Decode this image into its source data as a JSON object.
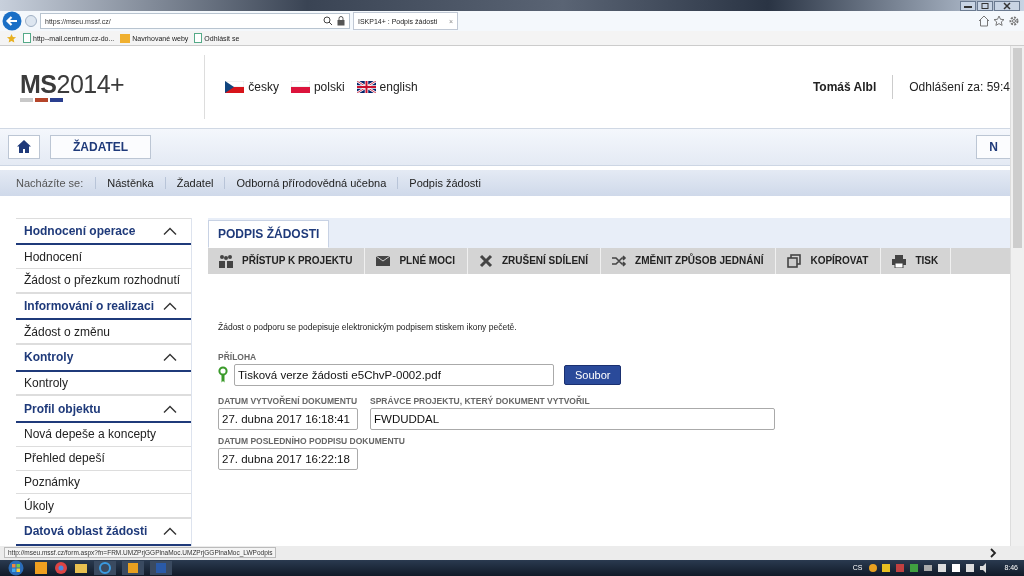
{
  "browser": {
    "address": "https://mseu.mssf.cz/",
    "tab": {
      "title": "ISKP14+ : Podpis žádosti",
      "close": "×"
    },
    "favorites": [
      {
        "label": "http--mail.centrum.cz-do...",
        "kind": "page"
      },
      {
        "label": "Navrhované weby",
        "kind": "folder"
      },
      {
        "label": "Odhlásit se",
        "kind": "page"
      }
    ]
  },
  "header": {
    "logo": "**MS**2014+",
    "languages": [
      {
        "label": "česky",
        "kind": "cz"
      },
      {
        "label": "polski",
        "kind": "pl"
      },
      {
        "label": "english",
        "kind": "gb"
      }
    ],
    "user": "Tomáš Albl",
    "logout_timer": "Odhlášení za: 59:4"
  },
  "nav": {
    "items": [
      "ŽADATEL"
    ],
    "right_button": "N"
  },
  "breadcrumb": {
    "label": "Nacházíte se:",
    "items": [
      "Nástěnka",
      "Žadatel",
      "Odborná přírodovědná učebna",
      "Podpis žádosti"
    ]
  },
  "sidebar": {
    "sections": [
      {
        "title": "Hodnocení operace",
        "expanded": true,
        "items": [
          "Hodnocení",
          "Žádost o přezkum rozhodnutí"
        ]
      },
      {
        "title": "Informování o realizaci",
        "expanded": true,
        "items": [
          "Žádost o změnu"
        ]
      },
      {
        "title": "Kontroly",
        "expanded": true,
        "items": [
          "Kontroly"
        ]
      },
      {
        "title": "Profil objektu",
        "expanded": true,
        "items": [
          "Nová depeše a koncepty",
          "Přehled depeší",
          "Poznámky",
          "Úkoly"
        ]
      },
      {
        "title": "Datová oblast žádosti",
        "expanded": true
      }
    ]
  },
  "main": {
    "tabs": [
      {
        "label": "PODPIS ŽÁDOSTI",
        "selected": true
      }
    ],
    "toolbar": [
      {
        "label": "PŘÍSTUP K PROJEKTU",
        "kind": "people"
      },
      {
        "label": "PLNÉ MOCI",
        "kind": "mail"
      },
      {
        "label": "ZRUŠENÍ SDÍLENÍ",
        "kind": "cross"
      },
      {
        "label": "ZMĚNIT ZPŮSOB JEDNÁNÍ",
        "kind": "shuffle"
      },
      {
        "label": "KOPÍROVAT",
        "kind": "copy"
      },
      {
        "label": "TISK",
        "kind": "print"
      }
    ],
    "intro": "Žádost o podporu se podepisuje elektronickým podpisem stiskem ikony pečetě.",
    "attachment": {
      "label": "PŘÍLOHA",
      "value": "Tisková verze žádosti e5ChvP-0002.pdf",
      "button": "Soubor"
    },
    "field_rows": [
      [
        {
          "label": "DATUM VYTVOŘENÍ DOKUMENTU",
          "value": "27. dubna 2017 16:18:41",
          "kind": "date"
        },
        {
          "label": "SPRÁVCE PROJEKTU, KTERÝ DOKUMENT VYTVOŘIL",
          "value": "FWDUDDAL",
          "kind": "text"
        }
      ],
      [
        {
          "label": "DATUM POSLEDNÍHO PODPISU DOKUMENTU",
          "value": "27. dubna 2017 16:22:18",
          "kind": "date"
        }
      ]
    ]
  },
  "status_url": "http://mseu.mssf.cz/form.aspx?fn=FRM.UMZPrjGGPlnaMoc.UMZPrjGGPlnaMoc_LWPodpis",
  "taskbar": {
    "language": "CS",
    "time": "8:46"
  }
}
